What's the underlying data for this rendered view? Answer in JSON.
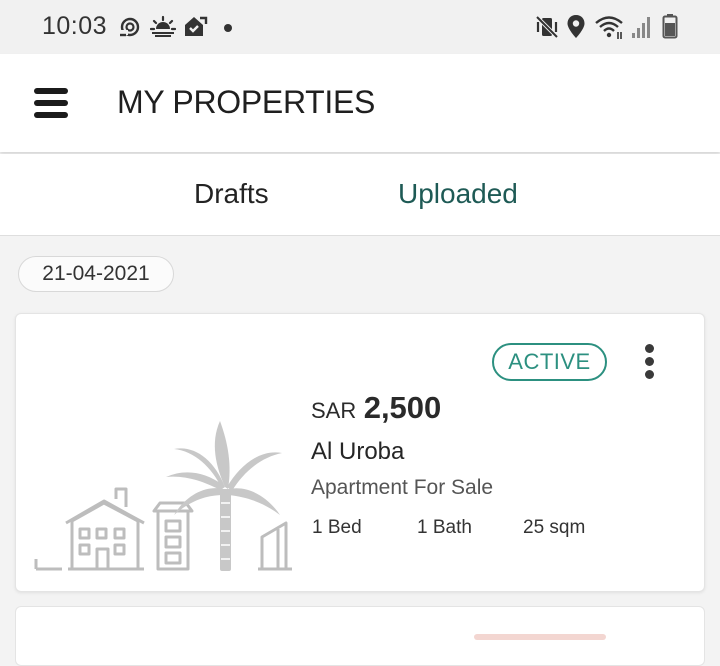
{
  "status_bar": {
    "time": "10:03",
    "left_icons": [
      "sync-icon",
      "sunrise-icon",
      "home-check-icon",
      "notification-dot-icon"
    ],
    "right_icons": [
      "vibrate-mute-icon",
      "location-pin-icon",
      "wifi-icon",
      "signal-icon",
      "battery-icon"
    ]
  },
  "app_bar": {
    "title": "MY PROPERTIES",
    "menu_icon": "hamburger-menu-icon"
  },
  "tabs": [
    {
      "label": "Drafts",
      "selected": false
    },
    {
      "label": "Uploaded",
      "selected": true
    }
  ],
  "colors": {
    "accent": "#1e5a55",
    "active_badge": "#2c9080"
  },
  "date_chip": "21-04-2021",
  "listings": [
    {
      "status": "ACTIVE",
      "currency": "SAR",
      "price": "2,500",
      "location": "Al Uroba",
      "type": "Apartment For Sale",
      "beds": "1 Bed",
      "baths": "1 Bath",
      "area": "25 sqm",
      "image_icon": "city-palm-placeholder-icon",
      "menu_icon": "more-vertical-icon"
    }
  ]
}
